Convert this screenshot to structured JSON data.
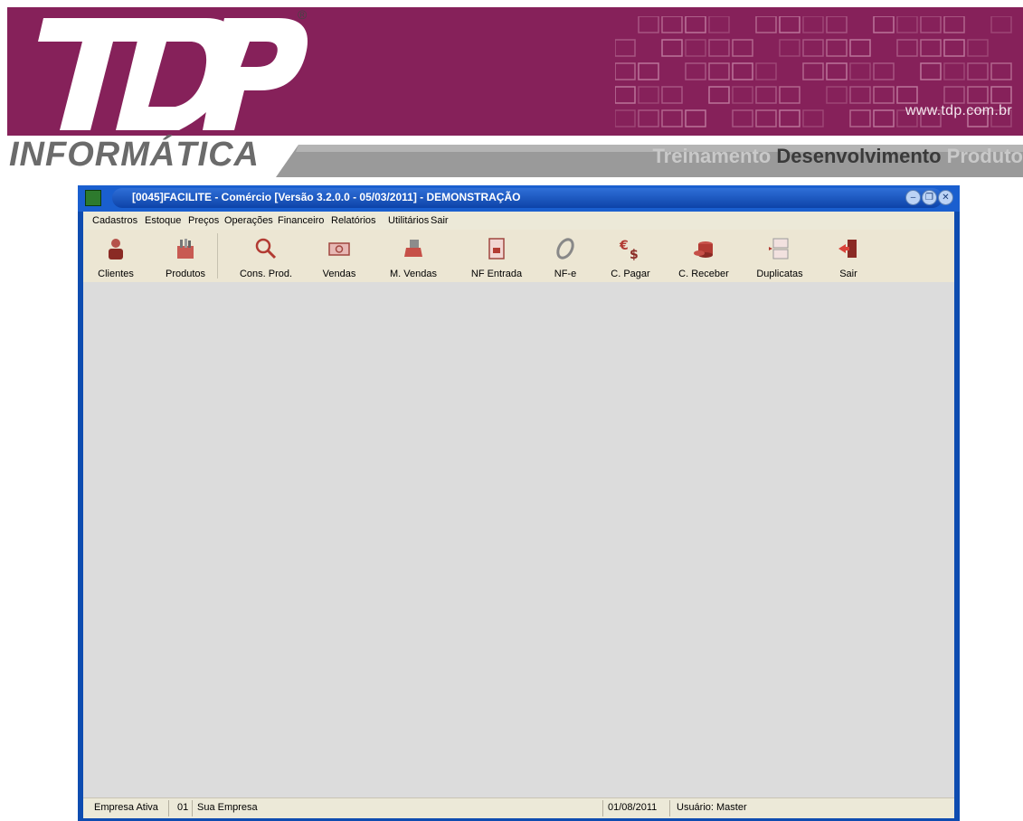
{
  "banner": {
    "logo_text": "TDP",
    "reg_mark": "®",
    "website": "www.tdp.com.br",
    "subtitle": "INFORMÁTICA",
    "tagline": [
      "Treinamento",
      "Desenvolvimento",
      "Produto"
    ],
    "brand_color": "#86215a"
  },
  "window": {
    "title": "[0045]FACILITE - Comércio [Versão 3.2.0.0 - 05/03/2011] - DEMONSTRAÇÃO",
    "controls": [
      "minimize-icon",
      "restore-icon",
      "close-icon"
    ],
    "titlebar_color": "#1a5fcf"
  },
  "menu": [
    "Cadastros",
    "Estoque",
    "Preços",
    "Operações",
    "Financeiro",
    "Relatórios",
    "Utilitários",
    "Sair"
  ],
  "toolbar": [
    {
      "label": "Clientes",
      "icon": "user-icon"
    },
    {
      "label": "Produtos",
      "icon": "box-icon"
    },
    {
      "label": "Cons. Prod.",
      "icon": "magnifier-icon"
    },
    {
      "label": "Vendas",
      "icon": "banknote-icon"
    },
    {
      "label": "M. Vendas",
      "icon": "cash-register-icon"
    },
    {
      "label": "NF Entrada",
      "icon": "document-icon"
    },
    {
      "label": "NF-e",
      "icon": "nfe-icon"
    },
    {
      "label": "C. Pagar",
      "icon": "currency-exchange-icon"
    },
    {
      "label": "C. Receber",
      "icon": "coins-icon"
    },
    {
      "label": "Duplicatas",
      "icon": "duplicates-icon"
    },
    {
      "label": "Sair",
      "icon": "exit-door-icon"
    }
  ],
  "status": {
    "empresa_label": "Empresa Ativa",
    "empresa_code": "01",
    "empresa_name": "Sua Empresa",
    "date": "01/08/2011",
    "user": "Usuário: Master"
  }
}
